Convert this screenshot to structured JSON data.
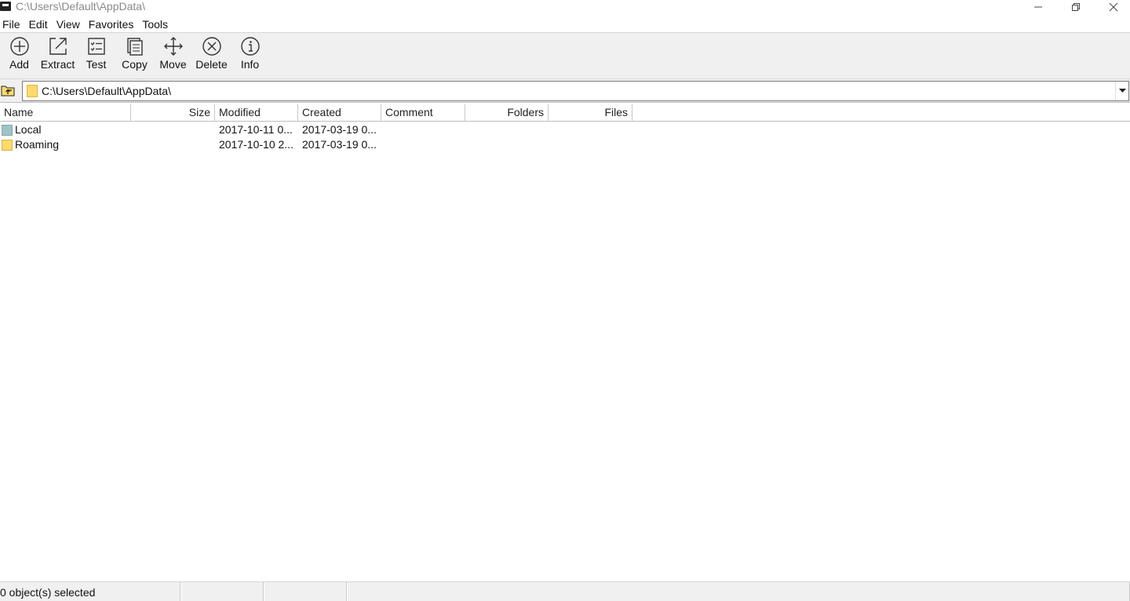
{
  "window": {
    "title": "C:\\Users\\Default\\AppData\\",
    "minimize_label": "—",
    "maximize_label": "❐",
    "close_label": "✕"
  },
  "menu": [
    {
      "label": "File"
    },
    {
      "label": "Edit"
    },
    {
      "label": "View"
    },
    {
      "label": "Favorites"
    },
    {
      "label": "Tools"
    }
  ],
  "toolbar": {
    "buttons": [
      {
        "label": "Add",
        "icon": "add-icon"
      },
      {
        "label": "Extract",
        "icon": "extract-icon"
      },
      {
        "label": "Test",
        "icon": "test-icon"
      },
      {
        "label": "Copy",
        "icon": "copy-icon"
      },
      {
        "label": "Move",
        "icon": "move-icon"
      },
      {
        "label": "Delete",
        "icon": "delete-icon"
      },
      {
        "label": "Info",
        "icon": "info-icon"
      }
    ]
  },
  "address": {
    "path": "C:\\Users\\Default\\AppData\\",
    "up_icon": "folder-up-icon",
    "dropdown_icon": "chevron-down-icon"
  },
  "columns": {
    "name": "Name",
    "size": "Size",
    "modified": "Modified",
    "created": "Created",
    "comment": "Comment",
    "folders": "Folders",
    "files": "Files"
  },
  "rows": [
    {
      "name": "Local",
      "size": "",
      "modified": "2017-10-11 0...",
      "created": "2017-03-19 0...",
      "icon_color": "#9fc3c8"
    },
    {
      "name": "Roaming",
      "size": "",
      "modified": "2017-10-10 2...",
      "created": "2017-03-19 0...",
      "icon_color": "#ffd96b"
    }
  ],
  "status": {
    "selection": "0 object(s) selected",
    "panel2": "",
    "panel3": "",
    "panel4": ""
  }
}
